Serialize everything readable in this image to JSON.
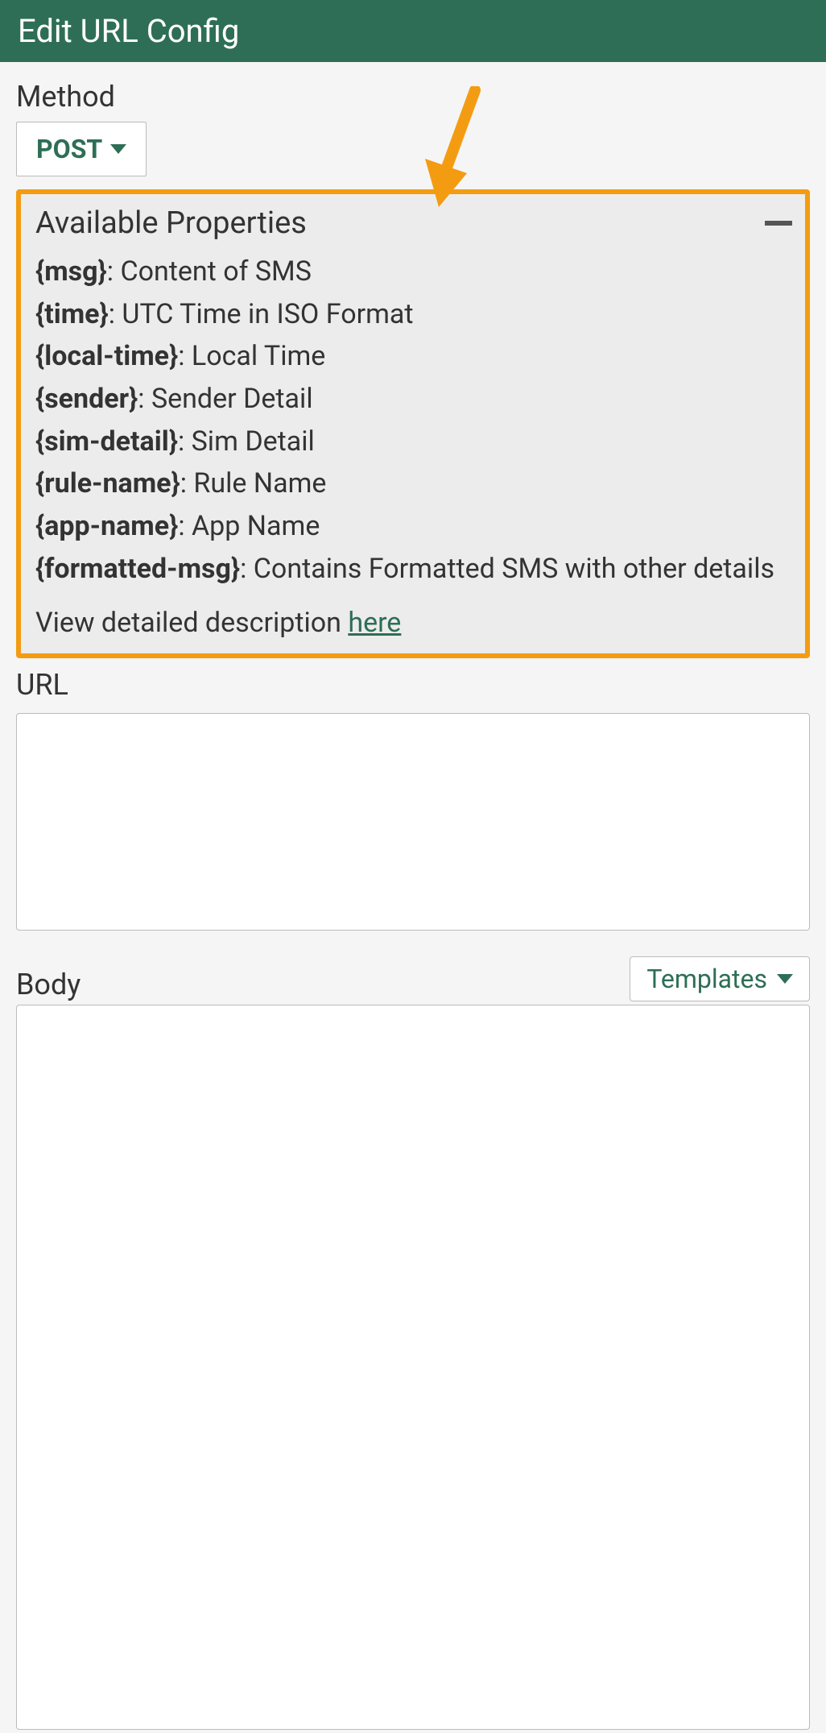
{
  "header": {
    "title": "Edit URL Config"
  },
  "method": {
    "label": "Method",
    "value": "POST"
  },
  "panel": {
    "title": "Available Properties",
    "properties": [
      {
        "key": "{msg}",
        "desc": "Content of SMS"
      },
      {
        "key": "{time}",
        "desc": "UTC Time in ISO Format"
      },
      {
        "key": "{local-time}",
        "desc": "Local Time"
      },
      {
        "key": "{sender}",
        "desc": "Sender Detail"
      },
      {
        "key": "{sim-detail}",
        "desc": "Sim Detail"
      },
      {
        "key": "{rule-name}",
        "desc": "Rule Name"
      },
      {
        "key": "{app-name}",
        "desc": "App Name"
      },
      {
        "key": "{formatted-msg}",
        "desc": "Contains Formatted SMS with other details"
      }
    ],
    "footer_text": "View detailed description ",
    "footer_link": "here"
  },
  "url": {
    "label": "URL",
    "value": ""
  },
  "body": {
    "label": "Body",
    "templates_label": "Templates",
    "value": ""
  },
  "colors": {
    "accent": "#2E6E56",
    "highlight": "#F39C12"
  }
}
